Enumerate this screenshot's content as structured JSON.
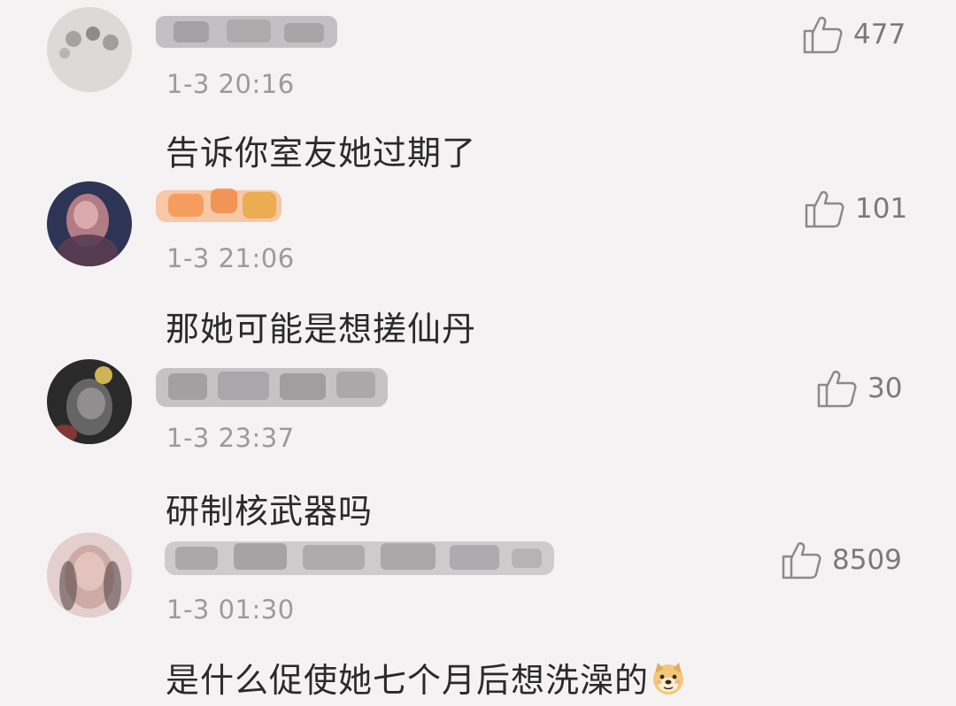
{
  "comments": [
    {
      "time": "1-3 20:16",
      "text": "告诉你室友她过期了",
      "likes": "477",
      "avatar_color": "#d9d6d4",
      "username_color": "#8a8a8a"
    },
    {
      "time": "1-3 21:06",
      "text": "那她可能是想搓仙丹",
      "likes": "101",
      "avatar_color": "#2b3253",
      "username_color": "#f08a3a"
    },
    {
      "time": "1-3 23:37",
      "text": "研制核武器吗",
      "likes": "30",
      "avatar_color": "#2a2a2a",
      "username_color": "#9a9a9a"
    },
    {
      "time": "1-3 01:30",
      "text": "是什么促使她七个月后想洗澡的",
      "likes": "8509",
      "avatar_color": "#d7b9b6",
      "username_color": "#9a9a9a"
    }
  ],
  "icons": {
    "like": "thumbs-up-icon",
    "emoji": "doge-emoji-icon"
  }
}
